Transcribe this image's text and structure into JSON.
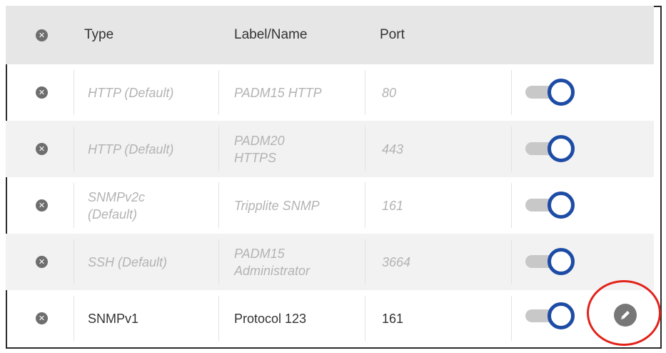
{
  "table": {
    "header": {
      "type": "Type",
      "label": "Label/Name",
      "port": "Port"
    },
    "rows": [
      {
        "type_line1": "HTTP (Default)",
        "type_line2": "",
        "label_line1": "PADM15 HTTP",
        "label_line2": "",
        "port": "80",
        "enabled": true,
        "is_default": true
      },
      {
        "type_line1": "HTTP (Default)",
        "type_line2": "",
        "label_line1": "PADM20",
        "label_line2": "HTTPS",
        "port": "443",
        "enabled": true,
        "is_default": true
      },
      {
        "type_line1": "SNMPv2c",
        "type_line2": "(Default)",
        "label_line1": "Tripplite SNMP",
        "label_line2": "",
        "port": "161",
        "enabled": true,
        "is_default": true
      },
      {
        "type_line1": "SSH (Default)",
        "type_line2": "",
        "label_line1": "PADM15",
        "label_line2": "Administrator",
        "port": "3664",
        "enabled": true,
        "is_default": true
      },
      {
        "type_line1": "SNMPv1",
        "type_line2": "",
        "label_line1": "Protocol 123",
        "label_line2": "",
        "port": "161",
        "enabled": true,
        "is_default": false
      }
    ]
  },
  "icons": {
    "delete": "close-icon",
    "edit": "pencil-icon"
  },
  "colors": {
    "toggle_knob": "#1d4ca6",
    "toggle_track": "#c8c8c8",
    "header_bg": "#e6e6e6",
    "highlight": "#e2231a"
  }
}
